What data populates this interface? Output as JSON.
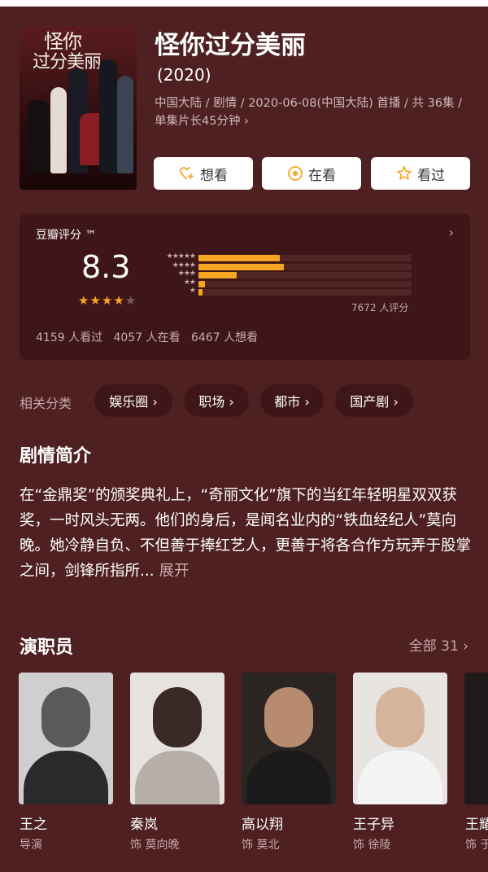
{
  "show": {
    "title": "怪你过分美丽",
    "year": "(2020)",
    "meta": "中国大陆 / 剧情 / 2020-06-08(中国大陆) 首播 / 共 36集 / 单集片长45分钟 ›",
    "poster_title_line1": "怪你",
    "poster_title_line2": "过分美丽"
  },
  "actions": {
    "want_label": "想看",
    "watching_label": "在看",
    "watched_label": "看过"
  },
  "rating": {
    "label": "豆瓣评分 ™",
    "arrow": "›",
    "score": "8.3",
    "stars_filled": 4,
    "stars_total": 5,
    "distribution": [
      {
        "label": "★★★★★",
        "fraction": 0.38
      },
      {
        "label": "★★★★",
        "fraction": 0.4
      },
      {
        "label": "★★★",
        "fraction": 0.18
      },
      {
        "label": "★★",
        "fraction": 0.03
      },
      {
        "label": "★",
        "fraction": 0.02
      }
    ],
    "count_text": "7672 人评分",
    "watched_text": "4159 人看过",
    "watching_text": "4057 人在看",
    "want_text": "6467 人想看"
  },
  "categories": {
    "label": "相关分类",
    "items": [
      "娱乐圈 ›",
      "职场 ›",
      "都市 ›",
      "国产剧 ›"
    ]
  },
  "synopsis": {
    "heading": "剧情简介",
    "text": "在“金鼎奖”的颁奖典礼上，“奇丽文化”旗下的当红年轻明星双双获奖，一时风头无两。他们的身后，是闻名业内的“铁血经纪人”莫向晚。她冷静自负、不但善于捧红艺人，更善于将各合作方玩弄于股掌之间，剑锋所指所...",
    "expand_label": "展开"
  },
  "cast": {
    "heading": "演职员",
    "all_label": "全部 31 ›",
    "members": [
      {
        "name": "王之",
        "role": "导演"
      },
      {
        "name": "秦岚",
        "role": "饰 莫向晚"
      },
      {
        "name": "高以翔",
        "role": "饰 莫北"
      },
      {
        "name": "王子异",
        "role": "饰 徐陵"
      },
      {
        "name": "王耀",
        "role": "饰 于"
      }
    ]
  },
  "colors": {
    "background": "#4e2022",
    "card": "#3f1618",
    "accent_star": "#f6a623",
    "muted_text": "#c9a9a9"
  }
}
